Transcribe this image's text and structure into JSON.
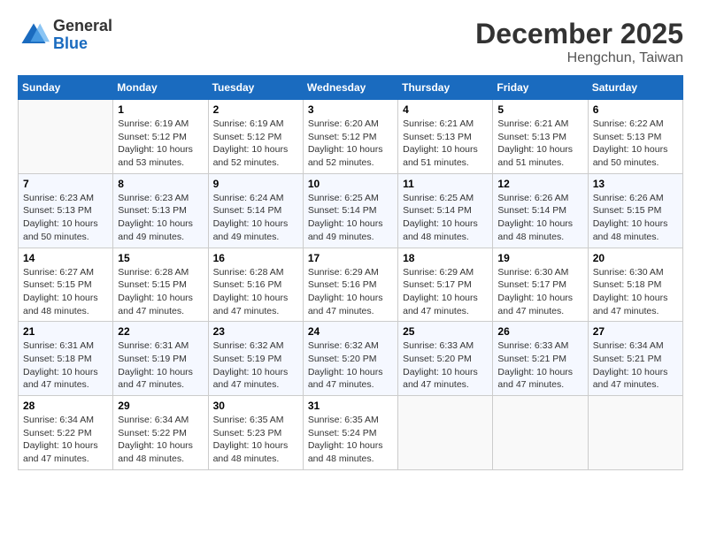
{
  "header": {
    "logo": {
      "general": "General",
      "blue": "Blue"
    },
    "title": "December 2025",
    "location": "Hengchun, Taiwan"
  },
  "calendar": {
    "days_of_week": [
      "Sunday",
      "Monday",
      "Tuesday",
      "Wednesday",
      "Thursday",
      "Friday",
      "Saturday"
    ],
    "weeks": [
      [
        {
          "day": "",
          "sunrise": "",
          "sunset": "",
          "daylight": "",
          "empty": true
        },
        {
          "day": "1",
          "sunrise": "Sunrise: 6:19 AM",
          "sunset": "Sunset: 5:12 PM",
          "daylight": "Daylight: 10 hours and 53 minutes."
        },
        {
          "day": "2",
          "sunrise": "Sunrise: 6:19 AM",
          "sunset": "Sunset: 5:12 PM",
          "daylight": "Daylight: 10 hours and 52 minutes."
        },
        {
          "day": "3",
          "sunrise": "Sunrise: 6:20 AM",
          "sunset": "Sunset: 5:12 PM",
          "daylight": "Daylight: 10 hours and 52 minutes."
        },
        {
          "day": "4",
          "sunrise": "Sunrise: 6:21 AM",
          "sunset": "Sunset: 5:13 PM",
          "daylight": "Daylight: 10 hours and 51 minutes."
        },
        {
          "day": "5",
          "sunrise": "Sunrise: 6:21 AM",
          "sunset": "Sunset: 5:13 PM",
          "daylight": "Daylight: 10 hours and 51 minutes."
        },
        {
          "day": "6",
          "sunrise": "Sunrise: 6:22 AM",
          "sunset": "Sunset: 5:13 PM",
          "daylight": "Daylight: 10 hours and 50 minutes."
        }
      ],
      [
        {
          "day": "7",
          "sunrise": "Sunrise: 6:23 AM",
          "sunset": "Sunset: 5:13 PM",
          "daylight": "Daylight: 10 hours and 50 minutes."
        },
        {
          "day": "8",
          "sunrise": "Sunrise: 6:23 AM",
          "sunset": "Sunset: 5:13 PM",
          "daylight": "Daylight: 10 hours and 49 minutes."
        },
        {
          "day": "9",
          "sunrise": "Sunrise: 6:24 AM",
          "sunset": "Sunset: 5:14 PM",
          "daylight": "Daylight: 10 hours and 49 minutes."
        },
        {
          "day": "10",
          "sunrise": "Sunrise: 6:25 AM",
          "sunset": "Sunset: 5:14 PM",
          "daylight": "Daylight: 10 hours and 49 minutes."
        },
        {
          "day": "11",
          "sunrise": "Sunrise: 6:25 AM",
          "sunset": "Sunset: 5:14 PM",
          "daylight": "Daylight: 10 hours and 48 minutes."
        },
        {
          "day": "12",
          "sunrise": "Sunrise: 6:26 AM",
          "sunset": "Sunset: 5:14 PM",
          "daylight": "Daylight: 10 hours and 48 minutes."
        },
        {
          "day": "13",
          "sunrise": "Sunrise: 6:26 AM",
          "sunset": "Sunset: 5:15 PM",
          "daylight": "Daylight: 10 hours and 48 minutes."
        }
      ],
      [
        {
          "day": "14",
          "sunrise": "Sunrise: 6:27 AM",
          "sunset": "Sunset: 5:15 PM",
          "daylight": "Daylight: 10 hours and 48 minutes."
        },
        {
          "day": "15",
          "sunrise": "Sunrise: 6:28 AM",
          "sunset": "Sunset: 5:15 PM",
          "daylight": "Daylight: 10 hours and 47 minutes."
        },
        {
          "day": "16",
          "sunrise": "Sunrise: 6:28 AM",
          "sunset": "Sunset: 5:16 PM",
          "daylight": "Daylight: 10 hours and 47 minutes."
        },
        {
          "day": "17",
          "sunrise": "Sunrise: 6:29 AM",
          "sunset": "Sunset: 5:16 PM",
          "daylight": "Daylight: 10 hours and 47 minutes."
        },
        {
          "day": "18",
          "sunrise": "Sunrise: 6:29 AM",
          "sunset": "Sunset: 5:17 PM",
          "daylight": "Daylight: 10 hours and 47 minutes."
        },
        {
          "day": "19",
          "sunrise": "Sunrise: 6:30 AM",
          "sunset": "Sunset: 5:17 PM",
          "daylight": "Daylight: 10 hours and 47 minutes."
        },
        {
          "day": "20",
          "sunrise": "Sunrise: 6:30 AM",
          "sunset": "Sunset: 5:18 PM",
          "daylight": "Daylight: 10 hours and 47 minutes."
        }
      ],
      [
        {
          "day": "21",
          "sunrise": "Sunrise: 6:31 AM",
          "sunset": "Sunset: 5:18 PM",
          "daylight": "Daylight: 10 hours and 47 minutes."
        },
        {
          "day": "22",
          "sunrise": "Sunrise: 6:31 AM",
          "sunset": "Sunset: 5:19 PM",
          "daylight": "Daylight: 10 hours and 47 minutes."
        },
        {
          "day": "23",
          "sunrise": "Sunrise: 6:32 AM",
          "sunset": "Sunset: 5:19 PM",
          "daylight": "Daylight: 10 hours and 47 minutes."
        },
        {
          "day": "24",
          "sunrise": "Sunrise: 6:32 AM",
          "sunset": "Sunset: 5:20 PM",
          "daylight": "Daylight: 10 hours and 47 minutes."
        },
        {
          "day": "25",
          "sunrise": "Sunrise: 6:33 AM",
          "sunset": "Sunset: 5:20 PM",
          "daylight": "Daylight: 10 hours and 47 minutes."
        },
        {
          "day": "26",
          "sunrise": "Sunrise: 6:33 AM",
          "sunset": "Sunset: 5:21 PM",
          "daylight": "Daylight: 10 hours and 47 minutes."
        },
        {
          "day": "27",
          "sunrise": "Sunrise: 6:34 AM",
          "sunset": "Sunset: 5:21 PM",
          "daylight": "Daylight: 10 hours and 47 minutes."
        }
      ],
      [
        {
          "day": "28",
          "sunrise": "Sunrise: 6:34 AM",
          "sunset": "Sunset: 5:22 PM",
          "daylight": "Daylight: 10 hours and 47 minutes."
        },
        {
          "day": "29",
          "sunrise": "Sunrise: 6:34 AM",
          "sunset": "Sunset: 5:22 PM",
          "daylight": "Daylight: 10 hours and 48 minutes."
        },
        {
          "day": "30",
          "sunrise": "Sunrise: 6:35 AM",
          "sunset": "Sunset: 5:23 PM",
          "daylight": "Daylight: 10 hours and 48 minutes."
        },
        {
          "day": "31",
          "sunrise": "Sunrise: 6:35 AM",
          "sunset": "Sunset: 5:24 PM",
          "daylight": "Daylight: 10 hours and 48 minutes."
        },
        {
          "day": "",
          "sunrise": "",
          "sunset": "",
          "daylight": "",
          "empty": true
        },
        {
          "day": "",
          "sunrise": "",
          "sunset": "",
          "daylight": "",
          "empty": true
        },
        {
          "day": "",
          "sunrise": "",
          "sunset": "",
          "daylight": "",
          "empty": true
        }
      ]
    ]
  }
}
